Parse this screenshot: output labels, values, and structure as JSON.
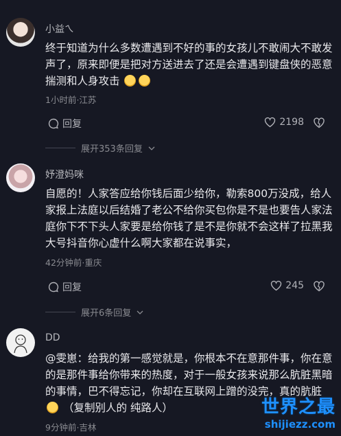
{
  "comments": [
    {
      "username": "小益ㄟ",
      "text": "终于知道为什么多数遭遇到不好的事的女孩儿不敢闹大不敢发声了，原来即便是把对方送进去了还是会遭遇到键盘侠的恶意揣测和人身攻击",
      "time_location": "1小时前·江苏",
      "reply_label": "回复",
      "like_count": "2198",
      "expand_label": "展开353条回复"
    },
    {
      "username": "妤澄妈咪",
      "text": "自愿的！人家答应给你钱后面少给你，勒索800万没成，给人家报上法庭以后结婚了老公不给你买包你是不是也要告人家法庭你下不下头人家要是给你钱了是不是你就不会这样了拉黑我大号抖音你心虚什么啊大家都在说事实，",
      "time_location": "42分钟前·重庆",
      "reply_label": "回复",
      "like_count": "245",
      "expand_label": "展开6条回复"
    },
    {
      "username": "DD",
      "text": "@雯崽：给我的第一感觉就是，你根本不在意那件事，你在意的是那件事给你带来的热度，对于一般女孩来说那么肮脏黑暗的事情，巴不得忘记，你却在互联网上蹭的没完，真的肮脏",
      "text_suffix": "（复制别人的 纯路人）",
      "time_location": "9分钟前·吉林"
    }
  ],
  "watermark": {
    "title": "世界之最",
    "url": "shijiezz.com"
  },
  "colors": {
    "background": "#161823",
    "watermark": "#1e90ff"
  }
}
